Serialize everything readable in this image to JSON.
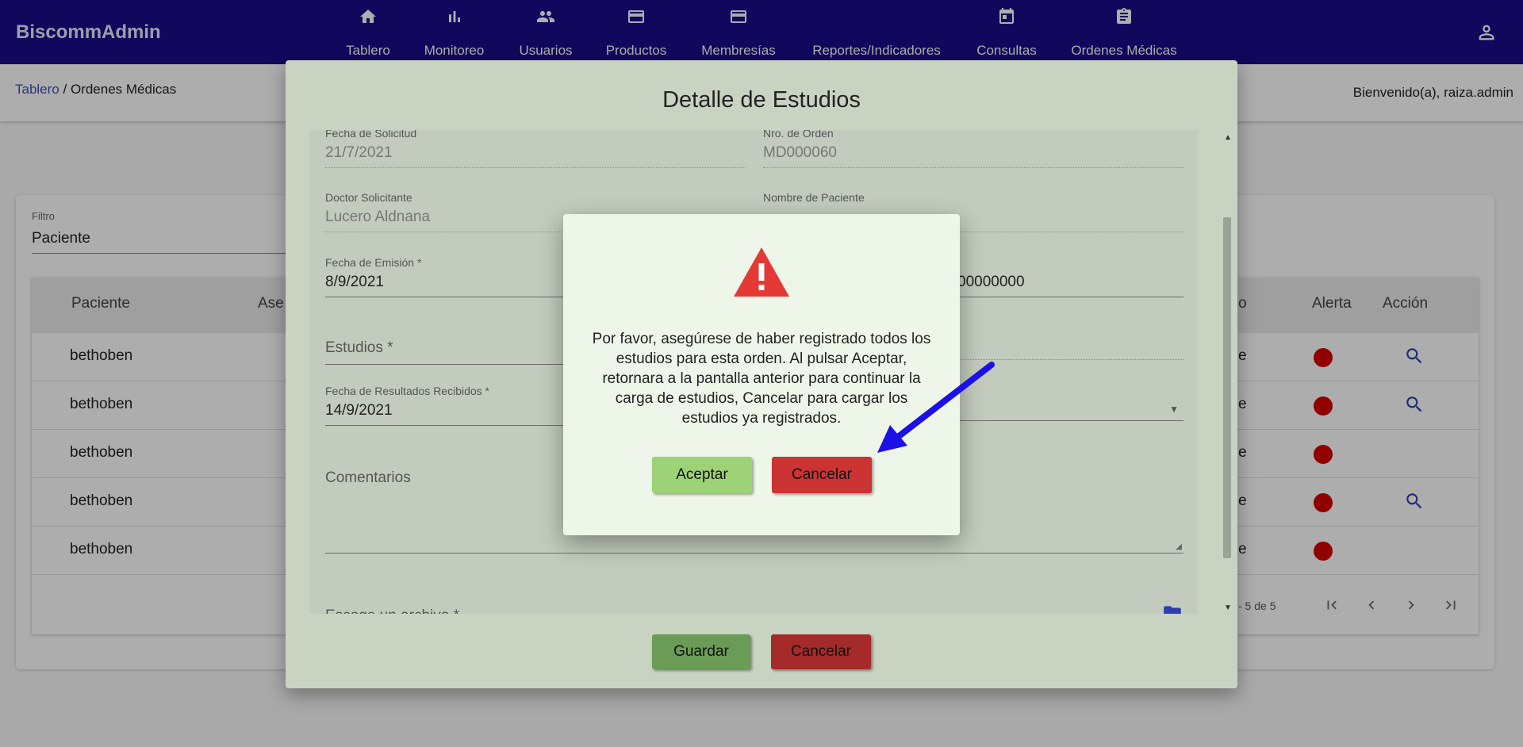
{
  "app": {
    "brand": "BiscommAdmin"
  },
  "nav": [
    {
      "label": "Tablero",
      "icon": "home-icon"
    },
    {
      "label": "Monitoreo",
      "icon": "bar-chart-icon"
    },
    {
      "label": "Usuarios",
      "icon": "people-icon"
    },
    {
      "label": "Productos",
      "icon": "credit-card-icon"
    },
    {
      "label": "Membresías",
      "icon": "credit-card-icon"
    },
    {
      "label": "Reportes/Indicadores",
      "icon": "none"
    },
    {
      "label": "Consultas",
      "icon": "calendar-icon"
    },
    {
      "label": "Ordenes Médicas",
      "icon": "clipboard-icon"
    }
  ],
  "breadcrumb": {
    "root": "Tablero",
    "separator": "/",
    "current": "Ordenes Médicas"
  },
  "welcome": "Bienvenido(a), raiza.admin",
  "filter": {
    "label": "Filtro",
    "value": "Paciente"
  },
  "table": {
    "headers": {
      "paciente": "Paciente",
      "asegurado": "Ase",
      "estado": "o",
      "alerta": "Alerta",
      "accion": "Acción"
    },
    "rows": [
      {
        "paciente": "bethoben",
        "estado": "e",
        "action": true
      },
      {
        "paciente": "bethoben",
        "estado": "e",
        "action": true
      },
      {
        "paciente": "bethoben",
        "estado": "e",
        "action": false
      },
      {
        "paciente": "bethoben",
        "estado": "e",
        "action": true
      },
      {
        "paciente": "bethoben",
        "estado": "e",
        "action": false
      }
    ],
    "range": "- 5 de 5"
  },
  "dialog": {
    "title": "Detalle de Estudios",
    "fields": {
      "fecha_solicitud_label": "Fecha de Solicitud",
      "fecha_solicitud": "21/7/2021",
      "nro_orden_label": "Nro. de Orden",
      "nro_orden": "MD000060",
      "doctor_label": "Doctor Solicitante",
      "doctor": "Lucero Aldnana",
      "paciente_label": "Nombre de Paciente",
      "fecha_emision_label": "Fecha de Emisión *",
      "fecha_emision": "8/9/2021",
      "numero_partial": "00000000",
      "estudios_label": "Estudios *",
      "fecha_resultados_label": "Fecha de Resultados Recibidos *",
      "fecha_resultados": "14/9/2021",
      "comentarios_label": "Comentarios",
      "archivo_label": "Escoge un archivo *"
    },
    "save_label": "Guardar",
    "cancel_label": "Cancelar"
  },
  "alert": {
    "message": "Por favor, asegúrese de haber registrado todos los estudios para esta orden. Al pulsar Aceptar, retornara a la pantalla anterior para continuar la carga de estudios, Cancelar para cargar los estudios ya registrados.",
    "accept_label": "Aceptar",
    "cancel_label": "Cancelar"
  },
  "colors": {
    "topbar": "#1a0d8a",
    "warning": "#e53935",
    "accept": "#9ed276",
    "cancel": "#cc3333",
    "arrow": "#1b10e6"
  }
}
